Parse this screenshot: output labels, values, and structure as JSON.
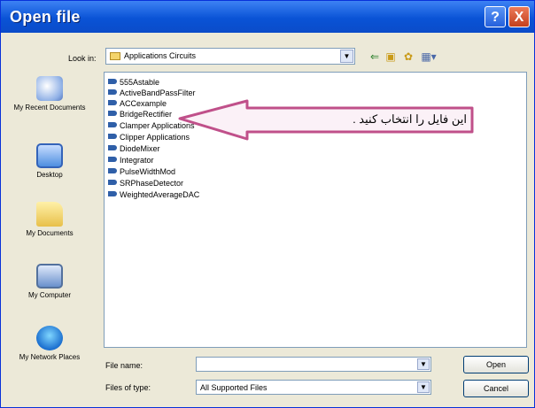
{
  "window": {
    "title": "Open file",
    "help_label": "?",
    "close_label": "X"
  },
  "look_in": {
    "label": "Look in:",
    "value": "Applications Circuits"
  },
  "toolbar": {
    "back": "⇐",
    "up": "▣",
    "new_folder": "✿",
    "views": "▦▾"
  },
  "places": [
    {
      "label": "My Recent Documents",
      "icon": "recent-documents-icon"
    },
    {
      "label": "Desktop",
      "icon": "desktop-icon"
    },
    {
      "label": "My Documents",
      "icon": "my-documents-icon"
    },
    {
      "label": "My Computer",
      "icon": "my-computer-icon"
    },
    {
      "label": "My Network Places",
      "icon": "network-places-icon"
    }
  ],
  "files": [
    "555Astable",
    "ActiveBandPassFilter",
    "ACCexample",
    "BridgeRectifier",
    "Clamper Applications",
    "Clipper Applications",
    "DiodeMixer",
    "Integrator",
    "PulseWidthMod",
    "SRPhaseDetector",
    "WeightedAverageDAC"
  ],
  "callout": {
    "text": "این فایل را انتخاب کنید ."
  },
  "file_name": {
    "label": "File name:",
    "value": ""
  },
  "file_type": {
    "label": "Files of type:",
    "value": "All Supported Files"
  },
  "buttons": {
    "open": "Open",
    "cancel": "Cancel"
  },
  "colors": {
    "titlebar": "#0a53d6",
    "accent_arrow": "#c0508a"
  }
}
